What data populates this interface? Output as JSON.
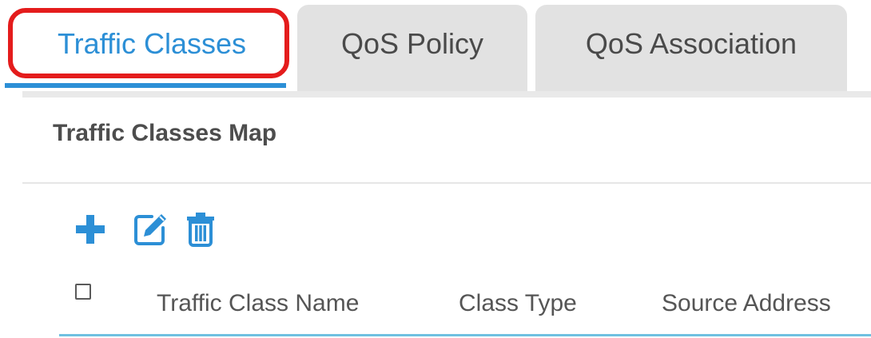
{
  "tabs": [
    {
      "label": "Traffic Classes",
      "active": true
    },
    {
      "label": "QoS Policy",
      "active": false
    },
    {
      "label": "QoS Association",
      "active": false
    }
  ],
  "section": {
    "title": "Traffic Classes Map"
  },
  "toolbar": {
    "add_icon": "plus-icon",
    "edit_icon": "edit-pencil-icon",
    "delete_icon": "trash-icon"
  },
  "table": {
    "columns": [
      "Traffic Class Name",
      "Class Type",
      "Source Address"
    ]
  },
  "colors": {
    "accent": "#2c8fd6",
    "highlight": "#e41c1c",
    "header_rule": "#6fc0e0"
  }
}
